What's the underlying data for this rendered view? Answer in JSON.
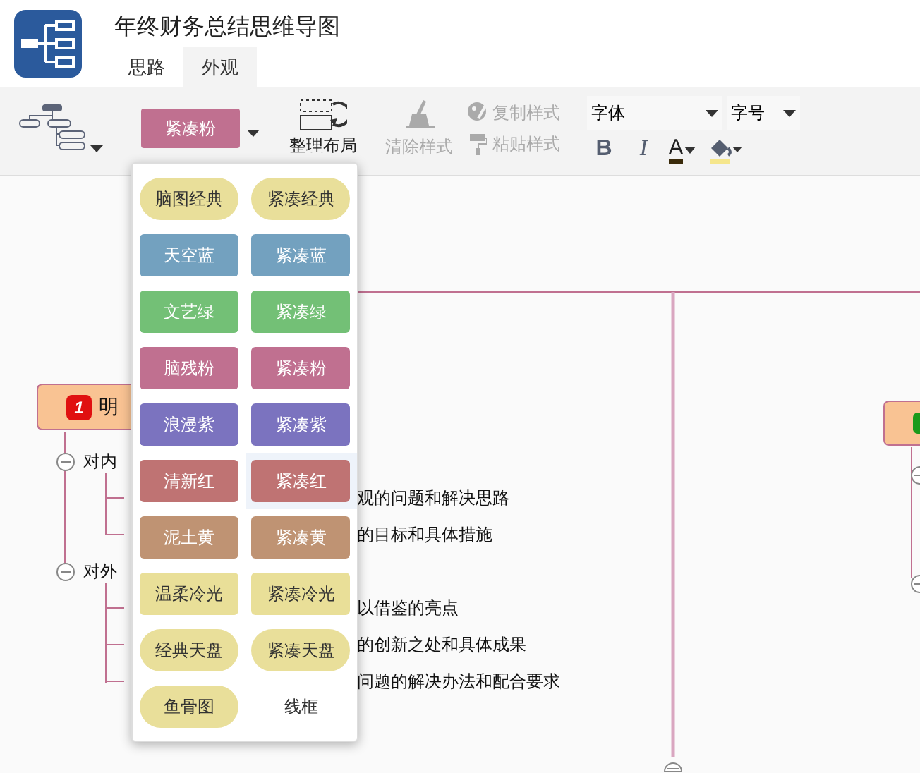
{
  "window": {
    "title": "年终财务总结思维导图"
  },
  "tabs": [
    {
      "label": "思路",
      "selected": false
    },
    {
      "label": "外观",
      "selected": true
    }
  ],
  "toolbar": {
    "theme_button": {
      "label": "紧凑粉",
      "color": "#c07090"
    },
    "layout_button": {
      "label": "整理布局"
    },
    "style_buttons": [
      {
        "label": "清除样式",
        "disabled": true
      },
      {
        "label": "复制样式",
        "disabled": true
      },
      {
        "label": "粘贴样式",
        "disabled": true
      }
    ],
    "font_select": {
      "label": "字体"
    },
    "size_select": {
      "label": "字号"
    },
    "format_buttons": [
      {
        "label": "B",
        "kind": "bold"
      },
      {
        "label": "I",
        "kind": "italic"
      },
      {
        "label": "A",
        "kind": "color"
      }
    ]
  },
  "theme_menu": [
    {
      "label": "脑图经典",
      "color": "#e9df9a",
      "kind": "pill",
      "dark_text": true,
      "selected": false
    },
    {
      "label": "紧凑经典",
      "color": "#e9df9a",
      "kind": "pill",
      "dark_text": true,
      "selected": false
    },
    {
      "label": "天空蓝",
      "color": "#73a1bf",
      "kind": "rect",
      "dark_text": false,
      "selected": false
    },
    {
      "label": "紧凑蓝",
      "color": "#73a1bf",
      "kind": "rect",
      "dark_text": false,
      "selected": false
    },
    {
      "label": "文艺绿",
      "color": "#73c076",
      "kind": "rect",
      "dark_text": false,
      "selected": false
    },
    {
      "label": "紧凑绿",
      "color": "#73c076",
      "kind": "rect",
      "dark_text": false,
      "selected": false
    },
    {
      "label": "脑残粉",
      "color": "#c07090",
      "kind": "rect",
      "dark_text": false,
      "selected": false
    },
    {
      "label": "紧凑粉",
      "color": "#c07090",
      "kind": "rect",
      "dark_text": false,
      "selected": false
    },
    {
      "label": "浪漫紫",
      "color": "#7b73bf",
      "kind": "rect",
      "dark_text": false,
      "selected": false
    },
    {
      "label": "紧凑紫",
      "color": "#7b73bf",
      "kind": "rect",
      "dark_text": false,
      "selected": false
    },
    {
      "label": "清新红",
      "color": "#bf7373",
      "kind": "rect",
      "dark_text": false,
      "selected": false
    },
    {
      "label": "紧凑红",
      "color": "#bf7373",
      "kind": "rect",
      "dark_text": false,
      "selected": true
    },
    {
      "label": "泥土黄",
      "color": "#bf9373",
      "kind": "rect",
      "dark_text": false,
      "selected": false
    },
    {
      "label": "紧凑黄",
      "color": "#bf9373",
      "kind": "rect",
      "dark_text": false,
      "selected": false
    },
    {
      "label": "温柔冷光",
      "color": "#e9df98",
      "kind": "rect",
      "dark_text": true,
      "selected": false
    },
    {
      "label": "紧凑冷光",
      "color": "#e9df98",
      "kind": "rect",
      "dark_text": true,
      "selected": false
    },
    {
      "label": "经典天盘",
      "color": "#e9df9a",
      "kind": "pill",
      "dark_text": true,
      "selected": false
    },
    {
      "label": "紧凑天盘",
      "color": "#e9df9a",
      "kind": "pill",
      "dark_text": true,
      "selected": false
    },
    {
      "label": "鱼骨图",
      "color": "#e9df9a",
      "kind": "pill",
      "dark_text": true,
      "selected": false
    },
    {
      "label": "线框",
      "color": "#ffffff",
      "kind": "plain",
      "dark_text": true,
      "selected": false
    }
  ],
  "mind_map": {
    "left_node": {
      "badge": "1",
      "label": "明"
    },
    "groups": [
      {
        "label": "对内",
        "items": [
          {
            "right": "观的问题和解决思路"
          },
          {
            "right": "的目标和具体措施"
          }
        ]
      },
      {
        "label": "对外",
        "items": [
          {
            "right": "以借鉴的亮点"
          },
          {
            "right": "的创新之处和具体成果"
          },
          {
            "right": "问题的解决办法和配合要求"
          }
        ]
      }
    ]
  }
}
